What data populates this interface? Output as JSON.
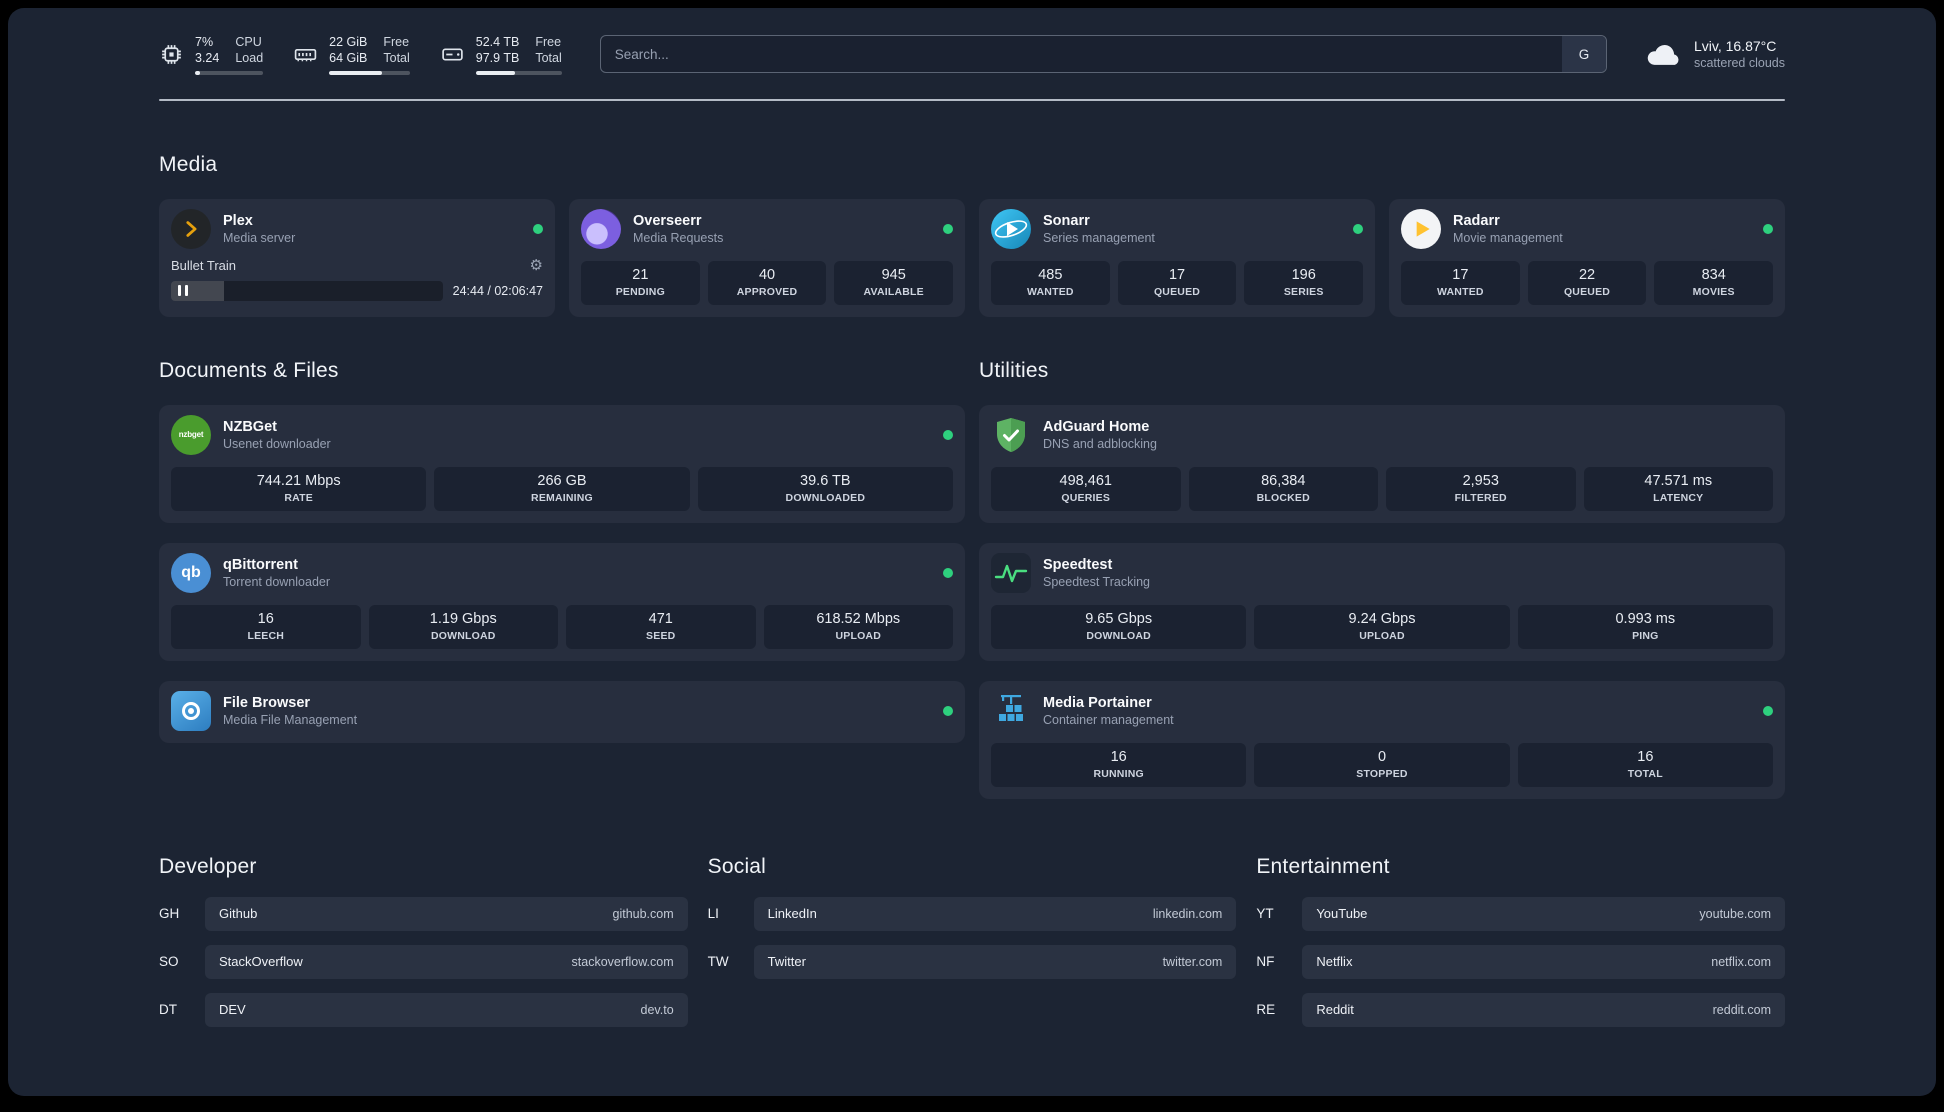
{
  "colors": {
    "page_background": "#1c2433",
    "card_background": "#272e3e",
    "stat_background": "#1b2231",
    "status_online": "#2ed07e",
    "plex_accent": "#e5a00d",
    "overseerr_accent": "#7c5fe0",
    "sonarr_accent": "#35c5f4",
    "radarr_accent": "#ffc230",
    "nzbget_accent": "#4a9c2d",
    "qbittorrent_accent": "#4a8fd4",
    "adguard_accent": "#5eb364",
    "speedtest_accent": "#4ade80",
    "portainer_accent": "#3fa8e0"
  },
  "topbar": {
    "resources": [
      {
        "icon": "cpu-icon",
        "value_top": "7%",
        "value_bottom": "3.24",
        "label_top": "CPU",
        "label_bottom": "Load",
        "progress": "7%"
      },
      {
        "icon": "memory-icon",
        "value_top": "22 GiB",
        "value_bottom": "64 GiB",
        "label_top": "Free",
        "label_bottom": "Total",
        "progress": "66%"
      },
      {
        "icon": "disk-icon",
        "value_top": "52.4 TB",
        "value_bottom": "97.9 TB",
        "label_top": "Free",
        "label_bottom": "Total",
        "progress": "46%"
      }
    ],
    "search": {
      "placeholder": "Search...",
      "provider_label": "G"
    },
    "weather": {
      "icon": "cloud-icon",
      "location": "Lviv, 16.87°C",
      "condition": "scattered clouds"
    }
  },
  "sections": {
    "media": {
      "title": "Media",
      "services": [
        {
          "name": "Plex",
          "description": "Media server",
          "icon": "plex-icon",
          "status": "online",
          "now_playing": {
            "title": "Bullet Train",
            "time_display": "24:44 / 02:06:47",
            "progress": "19.5%"
          }
        },
        {
          "name": "Overseerr",
          "description": "Media Requests",
          "icon": "overseerr-icon",
          "status": "online",
          "stats": [
            {
              "value": "21",
              "label": "PENDING"
            },
            {
              "value": "40",
              "label": "APPROVED"
            },
            {
              "value": "945",
              "label": "AVAILABLE"
            }
          ]
        },
        {
          "name": "Sonarr",
          "description": "Series management",
          "icon": "sonarr-icon",
          "status": "online",
          "stats": [
            {
              "value": "485",
              "label": "WANTED"
            },
            {
              "value": "17",
              "label": "QUEUED"
            },
            {
              "value": "196",
              "label": "SERIES"
            }
          ]
        },
        {
          "name": "Radarr",
          "description": "Movie management",
          "icon": "radarr-icon",
          "status": "online",
          "stats": [
            {
              "value": "17",
              "label": "WANTED"
            },
            {
              "value": "22",
              "label": "QUEUED"
            },
            {
              "value": "834",
              "label": "MOVIES"
            }
          ]
        }
      ]
    },
    "documents": {
      "title": "Documents & Files",
      "services": [
        {
          "name": "NZBGet",
          "description": "Usenet downloader",
          "icon": "nzbget-icon",
          "status": "online",
          "stats": [
            {
              "value": "744.21 Mbps",
              "label": "RATE"
            },
            {
              "value": "266 GB",
              "label": "REMAINING"
            },
            {
              "value": "39.6 TB",
              "label": "DOWNLOADED"
            }
          ]
        },
        {
          "name": "qBittorrent",
          "description": "Torrent downloader",
          "icon": "qbittorrent-icon",
          "status": "online",
          "stats": [
            {
              "value": "16",
              "label": "LEECH"
            },
            {
              "value": "1.19 Gbps",
              "label": "DOWNLOAD"
            },
            {
              "value": "471",
              "label": "SEED"
            },
            {
              "value": "618.52 Mbps",
              "label": "UPLOAD"
            }
          ]
        },
        {
          "name": "File Browser",
          "description": "Media File Management",
          "icon": "filebrowser-icon",
          "status": "online"
        }
      ]
    },
    "utilities": {
      "title": "Utilities",
      "services": [
        {
          "name": "AdGuard Home",
          "description": "DNS and adblocking",
          "icon": "adguard-icon",
          "stats": [
            {
              "value": "498,461",
              "label": "QUERIES"
            },
            {
              "value": "86,384",
              "label": "BLOCKED"
            },
            {
              "value": "2,953",
              "label": "FILTERED"
            },
            {
              "value": "47.571 ms",
              "label": "LATENCY"
            }
          ]
        },
        {
          "name": "Speedtest",
          "description": "Speedtest Tracking",
          "icon": "speedtest-icon",
          "stats": [
            {
              "value": "9.65 Gbps",
              "label": "DOWNLOAD"
            },
            {
              "value": "9.24 Gbps",
              "label": "UPLOAD"
            },
            {
              "value": "0.993 ms",
              "label": "PING"
            }
          ]
        },
        {
          "name": "Media Portainer",
          "description": "Container management",
          "icon": "portainer-icon",
          "status": "online",
          "stats": [
            {
              "value": "16",
              "label": "RUNNING"
            },
            {
              "value": "0",
              "label": "STOPPED"
            },
            {
              "value": "16",
              "label": "TOTAL"
            }
          ]
        }
      ]
    }
  },
  "bookmarks": [
    {
      "title": "Developer",
      "items": [
        {
          "abbr": "GH",
          "name": "Github",
          "url": "github.com"
        },
        {
          "abbr": "SO",
          "name": "StackOverflow",
          "url": "stackoverflow.com"
        },
        {
          "abbr": "DT",
          "name": "DEV",
          "url": "dev.to"
        }
      ]
    },
    {
      "title": "Social",
      "items": [
        {
          "abbr": "LI",
          "name": "LinkedIn",
          "url": "linkedin.com"
        },
        {
          "abbr": "TW",
          "name": "Twitter",
          "url": "twitter.com"
        }
      ]
    },
    {
      "title": "Entertainment",
      "items": [
        {
          "abbr": "YT",
          "name": "YouTube",
          "url": "youtube.com"
        },
        {
          "abbr": "NF",
          "name": "Netflix",
          "url": "netflix.com"
        },
        {
          "abbr": "RE",
          "name": "Reddit",
          "url": "reddit.com"
        }
      ]
    }
  ]
}
